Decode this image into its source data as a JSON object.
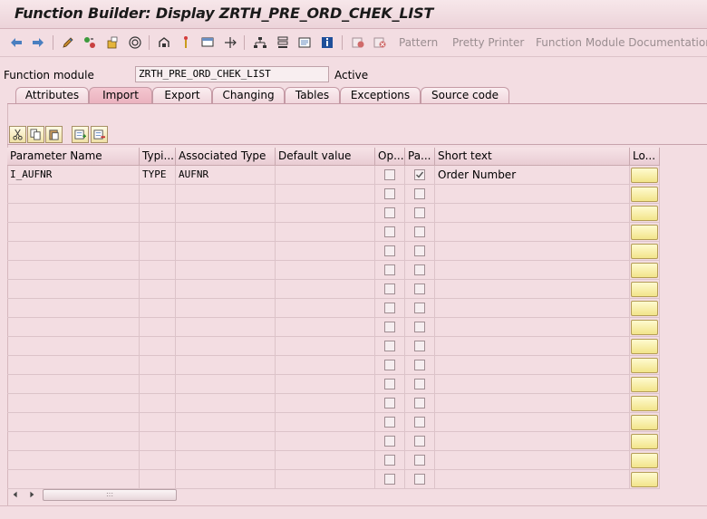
{
  "window": {
    "title": "Function Builder: Display ZRTH_PRE_ORD_CHEK_LIST"
  },
  "toolbar": {
    "icons": [
      "back-arrow-icon",
      "forward-arrow-icon",
      "edit-pencil-icon",
      "check-icon",
      "activate-icon",
      "where-used-icon",
      "other-object-icon",
      "test-icon",
      "display-object-list-icon",
      "navigate-icon",
      "hierarchy-icon",
      "stack-icon",
      "window-icon",
      "info-icon",
      "set-breakpoint-icon",
      "delete-breakpoint-icon"
    ],
    "pattern_label": "Pattern",
    "pretty_printer_label": "Pretty Printer",
    "fm_doc_label": "Function Module Documentation"
  },
  "function_module": {
    "label": "Function module",
    "value": "ZRTH_PRE_ORD_CHEK_LIST",
    "status": "Active"
  },
  "tabs": [
    {
      "label": "Attributes",
      "active": false
    },
    {
      "label": "Import",
      "active": true
    },
    {
      "label": "Export",
      "active": false
    },
    {
      "label": "Changing",
      "active": false
    },
    {
      "label": "Tables",
      "active": false
    },
    {
      "label": "Exceptions",
      "active": false
    },
    {
      "label": "Source code",
      "active": false
    }
  ],
  "grid_tools": [
    "cut-icon",
    "copy-icon",
    "paste-icon",
    "insert-row-icon",
    "delete-row-icon"
  ],
  "table": {
    "headers": [
      "Parameter Name",
      "Typi...",
      "Associated Type",
      "Default value",
      "Op...",
      "Pa...",
      "Short text",
      "Lo..."
    ],
    "rows": [
      {
        "param": "I_AUFNR",
        "typing": "TYPE",
        "assoc": "AUFNR",
        "default": "",
        "optional": false,
        "pass_value": true,
        "short_text": "Order Number"
      }
    ],
    "empty_row_count": 16
  },
  "scrollbar": {
    "grip": ":::"
  }
}
